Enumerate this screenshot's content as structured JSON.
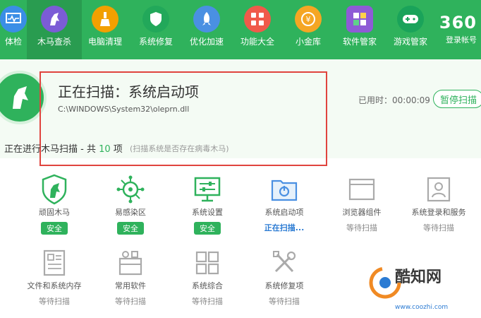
{
  "nav": [
    {
      "label": "体检",
      "color": "#3a8ee6"
    },
    {
      "label": "木马查杀",
      "color": "#7b5cd6"
    },
    {
      "label": "电脑清理",
      "color": "#f2a000"
    },
    {
      "label": "系统修复",
      "color": "#22a85a"
    },
    {
      "label": "优化加速",
      "color": "#4a90e2"
    },
    {
      "label": "功能大全",
      "color": "#f05a4a"
    },
    {
      "label": "小金库",
      "color": "#f5a623"
    },
    {
      "label": "软件管家",
      "color": "#8e5bd6"
    },
    {
      "label": "游戏管家",
      "color": "#1aa35a"
    }
  ],
  "brand": {
    "logo": "360",
    "account": "登录帐号"
  },
  "scan": {
    "title": "正在扫描：系统启动项",
    "path": "C:\\WINDOWS\\System32\\oleprn.dll",
    "elapsed": "已用时：00:00:09",
    "pause": "暂停扫描",
    "progress_prefix": "正在进行木马扫描 - 共",
    "progress_count": "10",
    "progress_suffix": "项",
    "hint": "(扫描系统是否存在病毒木马)"
  },
  "items": [
    {
      "name": "顽固木马",
      "status": "安全",
      "state": "safe"
    },
    {
      "name": "易感染区",
      "status": "安全",
      "state": "safe"
    },
    {
      "name": "系统设置",
      "status": "安全",
      "state": "safe"
    },
    {
      "name": "系统启动项",
      "status": "正在扫描...",
      "state": "scanning"
    },
    {
      "name": "浏览器组件",
      "status": "等待扫描",
      "state": "waiting"
    },
    {
      "name": "系统登录和服务",
      "status": "等待扫描",
      "state": "waiting"
    },
    {
      "name": "文件和系统内存",
      "status": "等待扫描",
      "state": "waiting"
    },
    {
      "name": "常用软件",
      "status": "等待扫描",
      "state": "waiting"
    },
    {
      "name": "系统综合",
      "status": "等待扫描",
      "state": "waiting"
    },
    {
      "name": "系统修复项",
      "status": "等待扫描",
      "state": "waiting"
    }
  ],
  "watermark": {
    "text": "酷知网",
    "url": "www.coozhi.com"
  }
}
